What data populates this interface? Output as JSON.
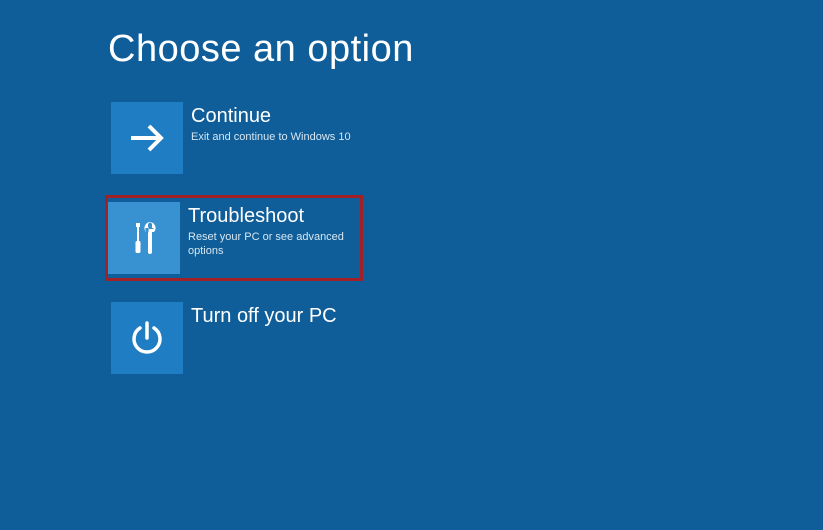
{
  "title": "Choose an option",
  "options": [
    {
      "title": "Continue",
      "desc": "Exit and continue to Windows 10"
    },
    {
      "title": "Troubleshoot",
      "desc": "Reset your PC or see advanced options"
    },
    {
      "title": "Turn off your PC",
      "desc": ""
    }
  ],
  "highlighted_index": 1,
  "colors": {
    "background": "#0f5d99",
    "tile": "#1f7ec3",
    "tile_highlight": "#3891d0",
    "highlight_border": "#a22126"
  }
}
